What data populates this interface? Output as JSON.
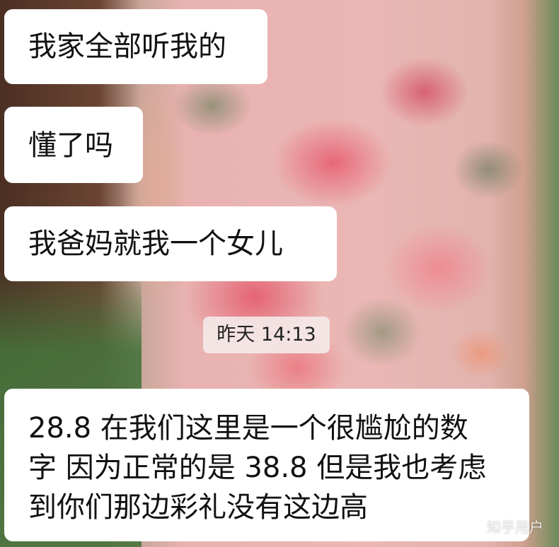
{
  "messages": [
    {
      "text": "我家全部听我的"
    },
    {
      "text": "懂了吗"
    },
    {
      "text": "我爸妈就我一个女儿"
    }
  ],
  "timestamp": "昨天 14:13",
  "latest_message": {
    "lines": [
      "28.8 在我们这里是一个很尴尬的数",
      "字 因为正常的是 38.8 但是我也考虑",
      "到你们那边彩礼没有这边高"
    ]
  },
  "watermark": "知乎用户",
  "colors": {
    "bubble": "#ffffff",
    "text": "#111111",
    "timestamp_bg": "#f5ecec"
  }
}
